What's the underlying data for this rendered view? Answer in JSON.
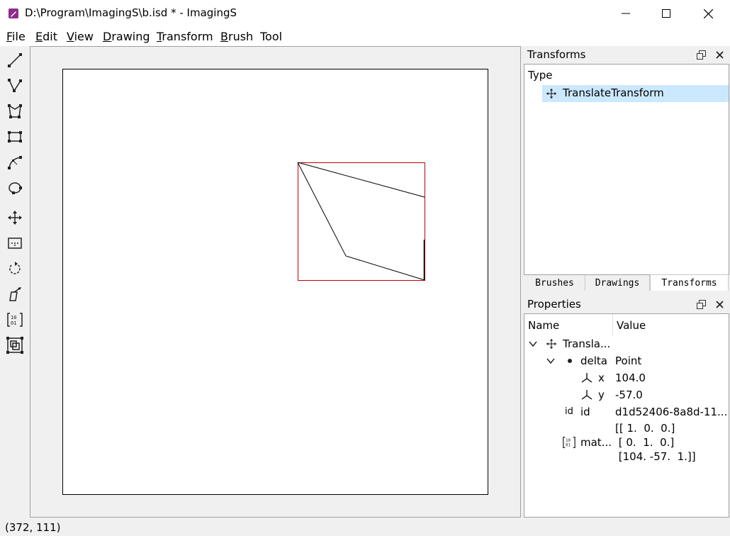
{
  "window": {
    "title": "D:\\Program\\ImagingS\\b.isd * - ImagingS"
  },
  "menu": [
    "File",
    "Edit",
    "View",
    "Drawing",
    "Transform",
    "Brush",
    "Tool"
  ],
  "menu_access_keys": [
    "F",
    "E",
    "V",
    "D",
    "T",
    "B",
    ""
  ],
  "toolbar": {
    "tools": [
      "line-tool-icon",
      "polyline-tool-icon",
      "polygon-tool-icon",
      "rectangle-tool-icon",
      "curve-tool-icon",
      "ellipse-tool-icon",
      "translate-tool-icon",
      "clip-tool-icon",
      "rotate-tool-icon",
      "skew-tool-icon",
      "matrix-tool-icon",
      "scale-tool-icon"
    ]
  },
  "transforms_panel": {
    "title": "Transforms",
    "header": "Type",
    "items": [
      {
        "label": "TranslateTransform",
        "icon": "move-icon",
        "selected": true
      }
    ]
  },
  "tabs": {
    "items": [
      "Brushes",
      "Drawings",
      "Transforms"
    ],
    "active": "Transforms"
  },
  "properties_panel": {
    "title": "Properties",
    "columns": [
      "Name",
      "Value"
    ],
    "root_name": "Transla...",
    "delta": {
      "name": "delta",
      "value": "Point"
    },
    "x": {
      "name": "x",
      "value": "104.0"
    },
    "y": {
      "name": "y",
      "value": "-57.0"
    },
    "id": {
      "icon_text": "id",
      "name": "id",
      "value": "d1d52406-8a8d-11..."
    },
    "matrix": {
      "name": "mat...",
      "rows": [
        "[[ 1.  0.  0.]",
        " [ 0.  1.  0.]",
        " [104. -57.  1.]]"
      ]
    }
  },
  "status": {
    "coordinates": "(372, 111)"
  },
  "colors": {
    "selection_highlight": "#cce8ff",
    "bounding_box": "#c00000"
  }
}
